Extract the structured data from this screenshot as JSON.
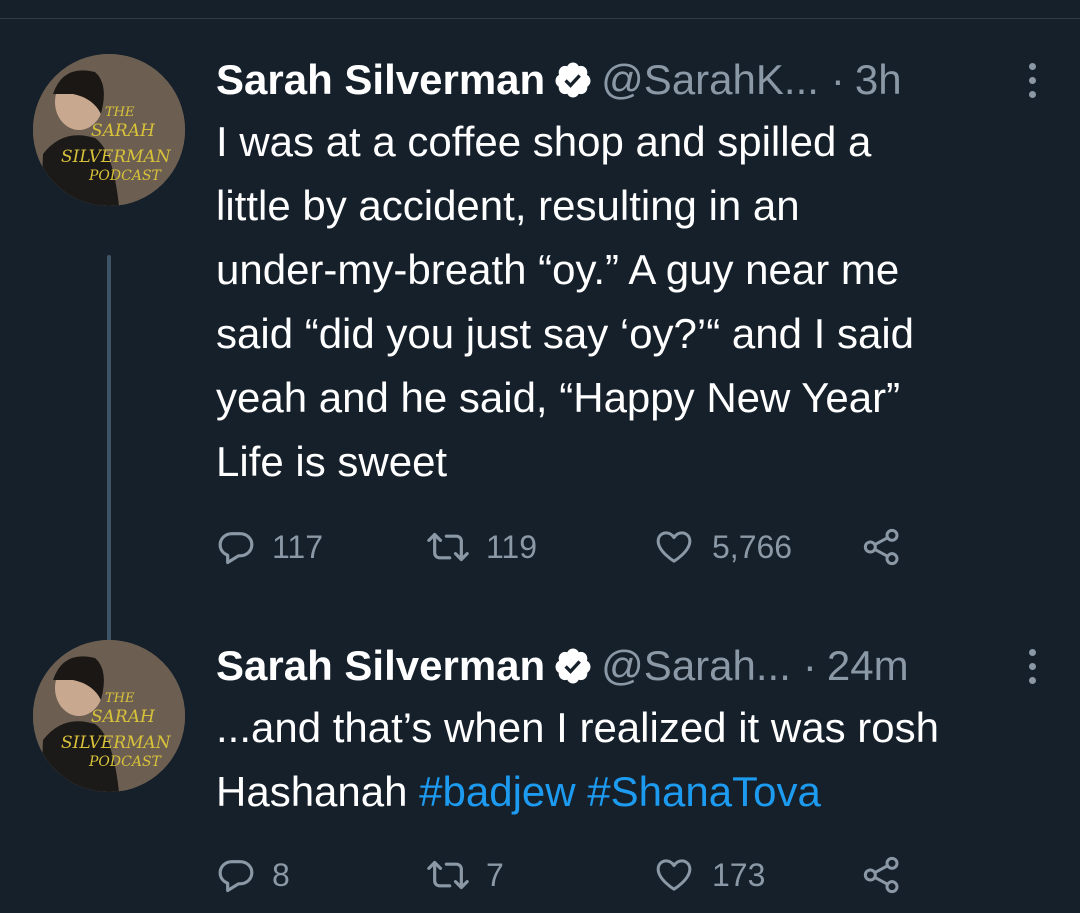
{
  "colors": {
    "background": "#15202b",
    "text": "#ffffff",
    "muted": "#8b98a5",
    "hashtag": "#1d9bf0",
    "verified_badge": "#ffffff",
    "thread_line": "#3e5466"
  },
  "tweets": [
    {
      "author": {
        "display_name": "Sarah Silverman",
        "handle": "@SarahK...",
        "verified_icon": "verified-badge-icon",
        "avatar_text": [
          "THE",
          "SARAH",
          "SILVERMAN",
          "PODCAST"
        ]
      },
      "separator": "·",
      "time": "3h",
      "text_lines": [
        "I was at a coffee shop and spilled a",
        "little by accident, resulting in an",
        "under-my-breath “oy.” A guy near me",
        "said “did you just say ‘oy?’“ and I said",
        "yeah and he said, “Happy New Year”",
        "Life is sweet"
      ],
      "actions": {
        "reply_count": "117",
        "retweet_count": "119",
        "like_count": "5,766"
      }
    },
    {
      "author": {
        "display_name": "Sarah Silverman",
        "handle": "@Sarah...",
        "verified_icon": "verified-badge-icon",
        "avatar_text": [
          "THE",
          "SARAH",
          "SILVERMAN",
          "PODCAST"
        ]
      },
      "separator": "·",
      "time": "24m",
      "text_line_1": "...and that’s when I realized it was rosh",
      "text_line_2_prefix": "Hashanah ",
      "hashtags": [
        "#badjew",
        "#ShanaTova"
      ],
      "actions": {
        "reply_count": "8",
        "retweet_count": "7",
        "like_count": "173"
      }
    }
  ]
}
